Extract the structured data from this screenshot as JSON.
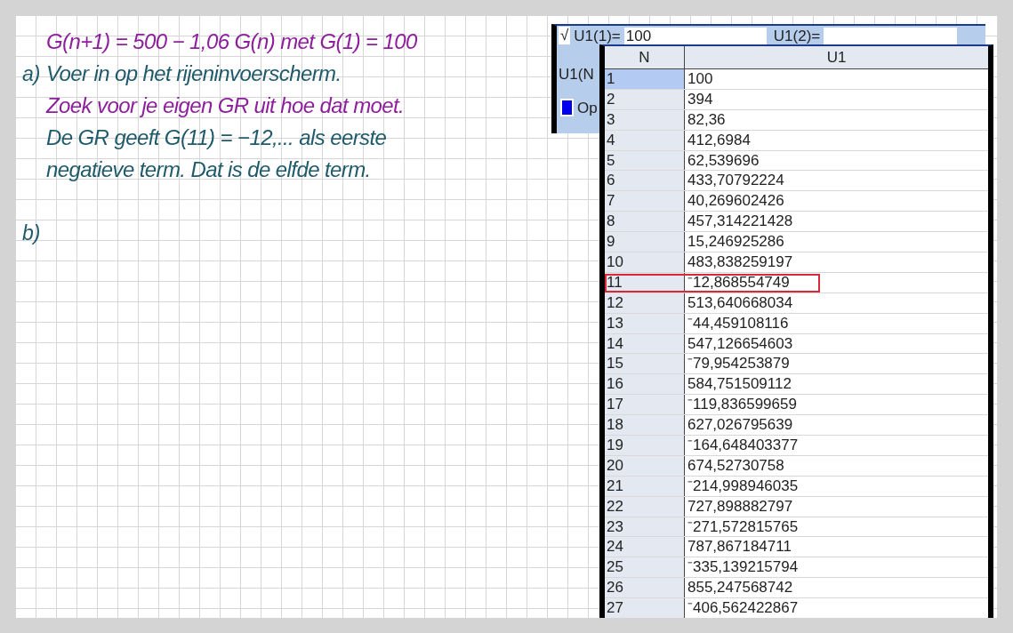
{
  "notes": [
    {
      "text": "G(n+1) = 500 − 1,06 G(n)  met  G(1) = 100",
      "color": "#8e1f9c"
    },
    {
      "marker": "a)",
      "text": "Voer in op het rijeninvoerscherm.",
      "color": "#1f5a6b"
    },
    {
      "text": "Zoek voor je eigen GR uit hoe dat moet.",
      "color": "#8e1f9c"
    },
    {
      "text": "De GR geeft G(11) = −12,... als eerste",
      "color": "#1f5a6b"
    },
    {
      "text": "negatieve term. Dat is de elfde term.",
      "color": "#1f5a6b"
    },
    {
      "marker": "b)",
      "color": "#1f5a6b"
    }
  ],
  "editor": {
    "check": "√",
    "u1_1_label": "U1(1)=",
    "u1_1_value": "100",
    "u1_2_label": "U1(2)=",
    "u1_n_label": "U1(N",
    "option_label": "Op",
    "option_checked": true
  },
  "table": {
    "columns": [
      "N",
      "U1"
    ],
    "rows": [
      {
        "n": "1",
        "u1": "100",
        "selected": true,
        "outlined": false
      },
      {
        "n": "2",
        "u1": "394",
        "selected": false,
        "outlined": false
      },
      {
        "n": "3",
        "u1": "82,36",
        "selected": false,
        "outlined": false
      },
      {
        "n": "4",
        "u1": "412,6984",
        "selected": false,
        "outlined": false
      },
      {
        "n": "5",
        "u1": "62,539696",
        "selected": false,
        "outlined": false
      },
      {
        "n": "6",
        "u1": "433,70792224",
        "selected": false,
        "outlined": false
      },
      {
        "n": "7",
        "u1": "40,269602426",
        "selected": false,
        "outlined": false
      },
      {
        "n": "8",
        "u1": "457,314221428",
        "selected": false,
        "outlined": false
      },
      {
        "n": "9",
        "u1": "15,246925286",
        "selected": false,
        "outlined": false
      },
      {
        "n": "10",
        "u1": "483,838259197",
        "selected": false,
        "outlined": false
      },
      {
        "n": "11",
        "u1": "⁻12,868554749",
        "selected": false,
        "outlined": true
      },
      {
        "n": "12",
        "u1": "513,640668034",
        "selected": false,
        "outlined": false
      },
      {
        "n": "13",
        "u1": "⁻44,459108116",
        "selected": false,
        "outlined": false
      },
      {
        "n": "14",
        "u1": "547,126654603",
        "selected": false,
        "outlined": false
      },
      {
        "n": "15",
        "u1": "⁻79,954253879",
        "selected": false,
        "outlined": false
      },
      {
        "n": "16",
        "u1": "584,751509112",
        "selected": false,
        "outlined": false
      },
      {
        "n": "17",
        "u1": "⁻119,836599659",
        "selected": false,
        "outlined": false
      },
      {
        "n": "18",
        "u1": "627,026795639",
        "selected": false,
        "outlined": false
      },
      {
        "n": "19",
        "u1": "⁻164,648403377",
        "selected": false,
        "outlined": false
      },
      {
        "n": "20",
        "u1": "674,52730758",
        "selected": false,
        "outlined": false
      },
      {
        "n": "21",
        "u1": "⁻214,998946035",
        "selected": false,
        "outlined": false
      },
      {
        "n": "22",
        "u1": "727,898882797",
        "selected": false,
        "outlined": false
      },
      {
        "n": "23",
        "u1": "⁻271,572815765",
        "selected": false,
        "outlined": false
      },
      {
        "n": "24",
        "u1": "787,867184711",
        "selected": false,
        "outlined": false
      },
      {
        "n": "25",
        "u1": "⁻335,139215794",
        "selected": false,
        "outlined": false
      },
      {
        "n": "26",
        "u1": "855,247568742",
        "selected": false,
        "outlined": false
      },
      {
        "n": "27",
        "u1": "⁻406,562422867",
        "selected": false,
        "outlined": false
      }
    ]
  }
}
